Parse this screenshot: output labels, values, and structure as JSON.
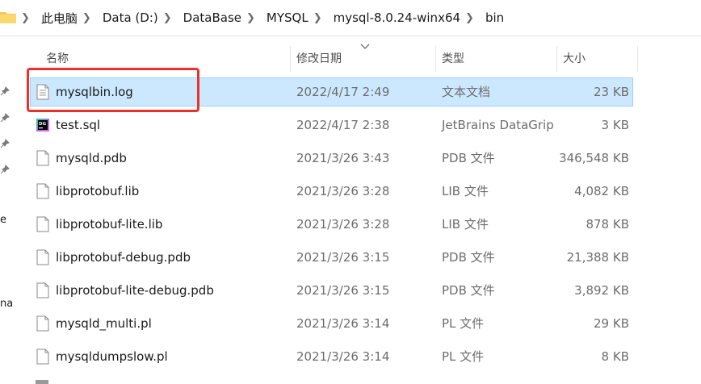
{
  "breadcrumb": {
    "items": [
      "此电脑",
      "Data (D:)",
      "DataBase",
      "MYSQL",
      "mysql-8.0.24-winx64",
      "bin"
    ]
  },
  "nav": {
    "fragment_1": "e",
    "fragment_2": "na"
  },
  "columns": {
    "name": "名称",
    "date": "修改日期",
    "type": "类型",
    "size": "大小"
  },
  "files": [
    {
      "name": "mysqlbin.log",
      "date": "2022/4/17 2:49",
      "type": "文本文档",
      "size": "23 KB",
      "icon": "text-document-icon",
      "selected": true
    },
    {
      "name": "test.sql",
      "date": "2022/4/17 2:38",
      "type": "JetBrains DataGrip",
      "size": "3 KB",
      "icon": "datagrip-icon",
      "selected": false
    },
    {
      "name": "mysqld.pdb",
      "date": "2021/3/26 3:43",
      "type": "PDB 文件",
      "size": "346,548 KB",
      "icon": "blank-file-icon",
      "selected": false
    },
    {
      "name": "libprotobuf.lib",
      "date": "2021/3/26 3:28",
      "type": "LIB 文件",
      "size": "4,082 KB",
      "icon": "blank-file-icon",
      "selected": false
    },
    {
      "name": "libprotobuf-lite.lib",
      "date": "2021/3/26 3:28",
      "type": "LIB 文件",
      "size": "878 KB",
      "icon": "blank-file-icon",
      "selected": false
    },
    {
      "name": "libprotobuf-debug.pdb",
      "date": "2021/3/26 3:15",
      "type": "PDB 文件",
      "size": "21,388 KB",
      "icon": "blank-file-icon",
      "selected": false
    },
    {
      "name": "libprotobuf-lite-debug.pdb",
      "date": "2021/3/26 3:15",
      "type": "PDB 文件",
      "size": "3,892 KB",
      "icon": "blank-file-icon",
      "selected": false
    },
    {
      "name": "mysqld_multi.pl",
      "date": "2021/3/26 3:14",
      "type": "PL 文件",
      "size": "29 KB",
      "icon": "blank-file-icon",
      "selected": false
    },
    {
      "name": "mysqldumpslow.pl",
      "date": "2021/3/26 3:14",
      "type": "PL 文件",
      "size": "8 KB",
      "icon": "blank-file-icon",
      "selected": false
    }
  ],
  "colors": {
    "selection_bg": "#cce8ff",
    "selection_border": "#99d1ff",
    "annotation": "#e8332a",
    "folder": "#f8c851"
  }
}
